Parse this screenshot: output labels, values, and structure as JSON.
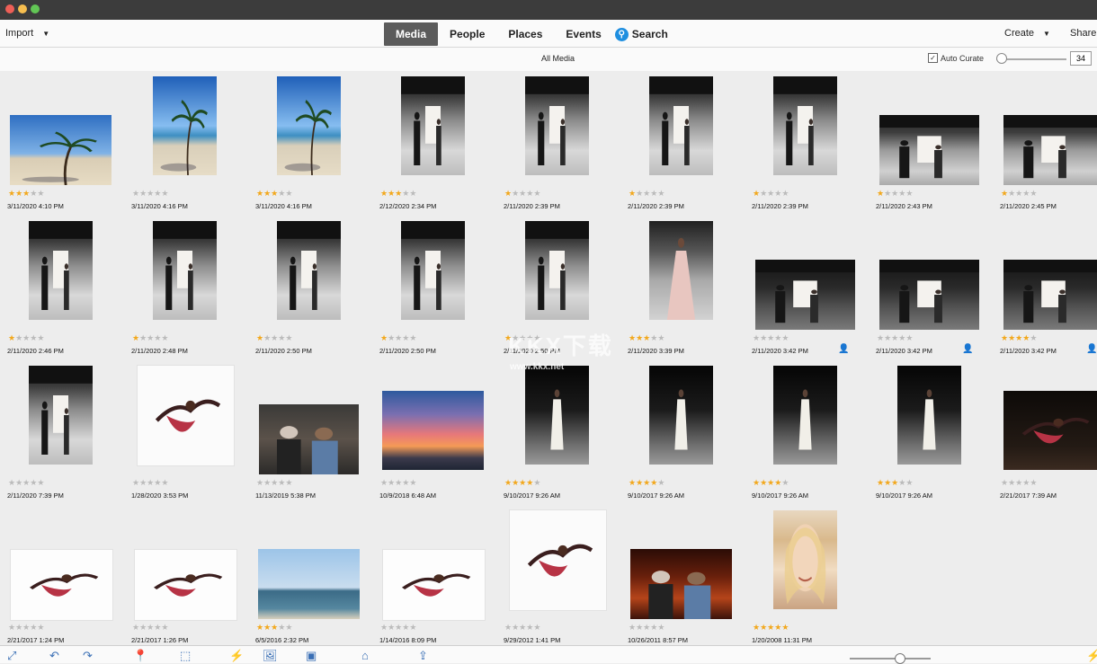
{
  "toolbar": {
    "import_label": "Import",
    "tabs": [
      "Media",
      "People",
      "Places",
      "Events"
    ],
    "search_label": "Search",
    "create_label": "Create",
    "share_label": "Share"
  },
  "subbar": {
    "view_label": "All Media",
    "auto_curate_label": "Auto Curate",
    "auto_curate_checked": true,
    "count_value": "34"
  },
  "watermark": {
    "text": "KKX下载",
    "url": "www.kkx.net"
  },
  "photos": [
    {
      "date": "3/11/2020 4:10 PM",
      "rating": 3,
      "scene": "palm-beach-wide"
    },
    {
      "date": "3/11/2020 4:16 PM",
      "rating": 0,
      "scene": "palm-beach-tall"
    },
    {
      "date": "3/11/2020 4:16 PM",
      "rating": 3,
      "scene": "palm-beach-tall"
    },
    {
      "date": "2/12/2020 2:34 PM",
      "rating": 3,
      "scene": "runway-tall"
    },
    {
      "date": "2/11/2020 2:39 PM",
      "rating": 1,
      "scene": "runway-tall"
    },
    {
      "date": "2/11/2020 2:39 PM",
      "rating": 1,
      "scene": "runway-tall"
    },
    {
      "date": "2/11/2020 2:39 PM",
      "rating": 1,
      "scene": "runway-tall"
    },
    {
      "date": "2/11/2020 2:43 PM",
      "rating": 1,
      "scene": "runway-wide"
    },
    {
      "date": "2/11/2020 2:45 PM",
      "rating": 1,
      "scene": "runway-wide"
    },
    {
      "date": "2/11/2020 2:46 PM",
      "rating": 1,
      "scene": "runway-tall"
    },
    {
      "date": "2/11/2020 2:48 PM",
      "rating": 1,
      "scene": "runway-tall"
    },
    {
      "date": "2/11/2020 2:50 PM",
      "rating": 1,
      "scene": "runway-tall"
    },
    {
      "date": "2/11/2020 2:50 PM",
      "rating": 1,
      "scene": "runway-tall"
    },
    {
      "date": "2/11/2020 2:50 PM",
      "rating": 1,
      "scene": "runway-tall"
    },
    {
      "date": "2/11/2020 3:39 PM",
      "rating": 3,
      "scene": "runway-gown"
    },
    {
      "date": "2/11/2020 3:42 PM",
      "rating": 0,
      "scene": "runway-dark-wide",
      "person": true
    },
    {
      "date": "2/11/2020 3:42 PM",
      "rating": 0,
      "scene": "runway-dark-wide",
      "person": true
    },
    {
      "date": "2/11/2020 3:42 PM",
      "rating": 4,
      "scene": "runway-dark-wide",
      "person": true
    },
    {
      "date": "2/11/2020 7:39 PM",
      "rating": 0,
      "scene": "runway-tall"
    },
    {
      "date": "1/28/2020 3:53 PM",
      "rating": 0,
      "scene": "dancer-white"
    },
    {
      "date": "11/13/2019 5:38 PM",
      "rating": 0,
      "scene": "crowd-wide"
    },
    {
      "date": "10/9/2018 6:48 AM",
      "rating": 0,
      "scene": "sunset-wide"
    },
    {
      "date": "9/10/2017 9:26 AM",
      "rating": 4,
      "scene": "runway-black"
    },
    {
      "date": "9/10/2017 9:26 AM",
      "rating": 4,
      "scene": "runway-black"
    },
    {
      "date": "9/10/2017 9:26 AM",
      "rating": 4,
      "scene": "runway-black"
    },
    {
      "date": "9/10/2017 9:26 AM",
      "rating": 3,
      "scene": "runway-black"
    },
    {
      "date": "2/21/2017 7:39 AM",
      "rating": 0,
      "scene": "dancers-dark"
    },
    {
      "date": "2/21/2017 1:24 PM",
      "rating": 0,
      "scene": "dancer-white-wide"
    },
    {
      "date": "2/21/2017 1:26 PM",
      "rating": 0,
      "scene": "dancer-white-wide"
    },
    {
      "date": "6/5/2016 2:32 PM",
      "rating": 3,
      "scene": "sea-wide"
    },
    {
      "date": "1/14/2016 8:09 PM",
      "rating": 0,
      "scene": "dancer-white-wide"
    },
    {
      "date": "9/29/2012 1:41 PM",
      "rating": 0,
      "scene": "dancer-white"
    },
    {
      "date": "10/26/2011 8:57 PM",
      "rating": 0,
      "scene": "concert-wide"
    },
    {
      "date": "1/20/2008 11:31 PM",
      "rating": 5,
      "scene": "portrait-tall"
    }
  ],
  "bottombar": {
    "icons": [
      "expand-icon",
      "undo-icon",
      "redo-icon",
      "map-pin-icon",
      "crop-icon",
      "flash-icon",
      "image-icon",
      "screen-icon",
      "home-icon",
      "share-icon",
      "lightning-icon"
    ]
  }
}
